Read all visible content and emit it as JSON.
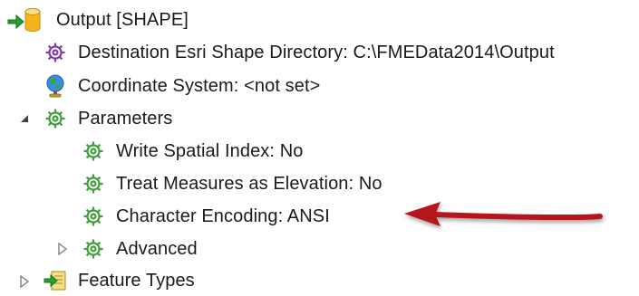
{
  "tree": {
    "output": {
      "label": "Output [SHAPE]",
      "icon": "database-writer-icon",
      "expanded": true
    },
    "destination": {
      "label": "Destination Esri Shape Directory: C:\\FMEData2014\\Output",
      "icon": "purple-gear-icon"
    },
    "coordinate_system": {
      "label": "Coordinate System: <not set>",
      "icon": "globe-icon"
    },
    "parameters": {
      "label": "Parameters",
      "icon": "green-gear-icon",
      "expanded": true,
      "children": [
        {
          "label": "Write Spatial Index: No",
          "icon": "green-gear-icon"
        },
        {
          "label": "Treat Measures as Elevation: No",
          "icon": "green-gear-icon"
        },
        {
          "label": "Character Encoding: ANSI",
          "icon": "green-gear-icon"
        },
        {
          "label": "Advanced",
          "icon": "green-gear-icon",
          "expanded": false
        }
      ]
    },
    "feature_types": {
      "label": "Feature Types",
      "icon": "feature-types-icon",
      "expanded": false
    }
  },
  "colors": {
    "text": "#1a1a1a",
    "purple_gear": "#7b3fa6",
    "green_gear": "#3f9f3a",
    "arrow": "#b3121a",
    "database_yellow": "#f3b51b",
    "green_arrow": "#22a32a"
  }
}
